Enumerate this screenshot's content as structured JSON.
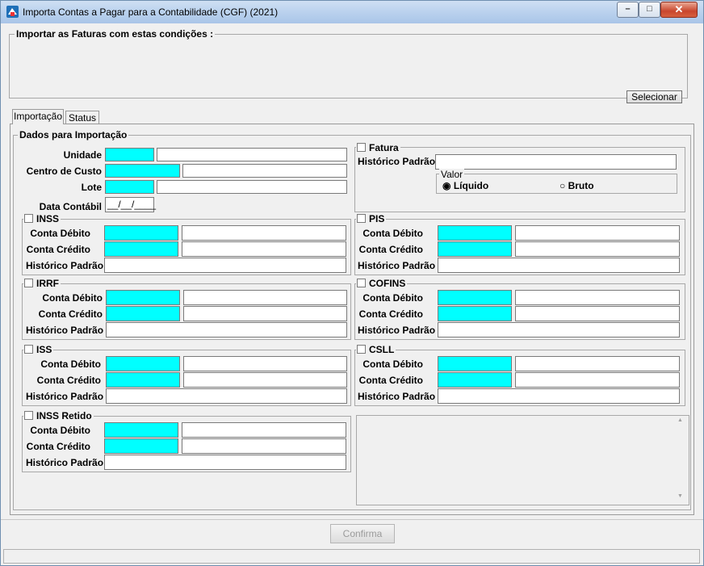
{
  "window": {
    "title": "Importa Contas a Pagar para a Contabilidade (CGF) (2021)",
    "minimize_glyph": "–",
    "maximize_glyph": "□",
    "close_glyph": "✕"
  },
  "conditions": {
    "legend": "Importar as Faturas com estas condições :",
    "select_button": "Selecionar"
  },
  "tabs": [
    {
      "label": "Importação",
      "active": true
    },
    {
      "label": "Status",
      "active": false
    }
  ],
  "import_data": {
    "legend": "Dados para Importação",
    "unidade_label": "Unidade",
    "centro_label": "Centro de Custo",
    "lote_label": "Lote",
    "data_label": "Data Contábil",
    "data_value": "__/__/____"
  },
  "fatura": {
    "legend": "Fatura",
    "historico_label": "Histórico Padrão",
    "valor_legend": "Valor",
    "liquido_label": "Líquido",
    "bruto_label": "Bruto"
  },
  "labels": {
    "debito": "Conta Débito",
    "credito": "Conta Crédito",
    "historico": "Histórico Padrão"
  },
  "groups": {
    "inss": "INSS",
    "irrf": "IRRF",
    "iss": "ISS",
    "inss_retido": "INSS Retido",
    "pis": "PIS",
    "cofins": "COFINS",
    "csll": "CSLL"
  },
  "footer": {
    "confirm_button": "Confirma"
  },
  "scroll": {
    "up": "▲",
    "down": "▼"
  },
  "colors": {
    "required_field": "#00ffff"
  }
}
